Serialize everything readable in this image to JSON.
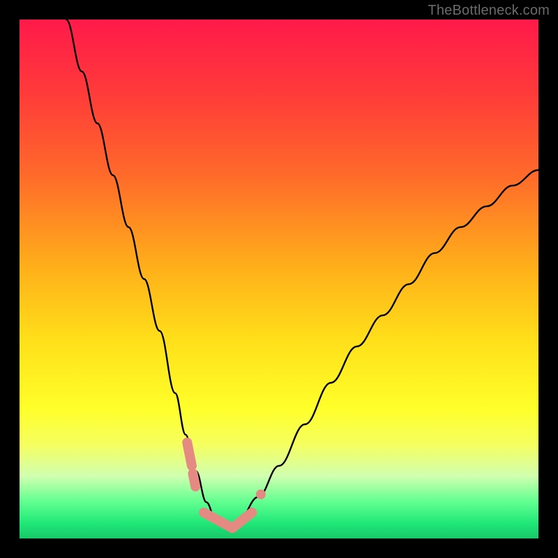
{
  "watermark": "TheBottleneck.com",
  "chart_data": {
    "type": "line",
    "title": "",
    "xlabel": "",
    "ylabel": "",
    "xlim": [
      0,
      100
    ],
    "ylim": [
      0,
      100
    ],
    "background_gradient": {
      "stops": [
        {
          "offset": 0.0,
          "color": "#ff1a4a"
        },
        {
          "offset": 0.14,
          "color": "#ff3a3a"
        },
        {
          "offset": 0.3,
          "color": "#ff6a2a"
        },
        {
          "offset": 0.48,
          "color": "#ffb01a"
        },
        {
          "offset": 0.62,
          "color": "#ffe01a"
        },
        {
          "offset": 0.75,
          "color": "#ffff2a"
        },
        {
          "offset": 0.82,
          "color": "#f5ff60"
        },
        {
          "offset": 0.88,
          "color": "#d0ffb0"
        },
        {
          "offset": 0.93,
          "color": "#60ff90"
        },
        {
          "offset": 0.97,
          "color": "#20e878"
        },
        {
          "offset": 1.0,
          "color": "#18c868"
        }
      ]
    },
    "series": [
      {
        "name": "bottleneck-curve",
        "x": [
          9.0,
          12.0,
          15.0,
          18.0,
          21.0,
          24.0,
          27.0,
          30.0,
          32.0,
          34.0,
          36.0,
          38.0,
          40.0,
          42.0,
          46.0,
          50.0,
          55.0,
          60.0,
          65.0,
          70.0,
          75.0,
          80.0,
          85.0,
          90.0,
          95.0,
          100.0
        ],
        "y": [
          100.0,
          90.0,
          80.0,
          70.0,
          60.0,
          50.0,
          40.0,
          28.0,
          20.0,
          13.0,
          7.0,
          3.0,
          2.0,
          3.0,
          8.0,
          14.0,
          22.0,
          30.0,
          37.0,
          43.0,
          49.0,
          55.0,
          60.0,
          64.0,
          68.0,
          71.0
        ]
      }
    ],
    "markers": {
      "name": "salmon-highlights",
      "color": "#e58a82",
      "segments": [
        {
          "x": [
            32.3,
            33.2
          ],
          "y": [
            18.5,
            14.0
          ]
        },
        {
          "x": [
            33.4,
            33.9
          ],
          "y": [
            12.5,
            10.0
          ]
        },
        {
          "x": [
            35.5,
            41.0
          ],
          "y": [
            5.0,
            2.0
          ]
        },
        {
          "x": [
            41.0,
            44.8
          ],
          "y": [
            2.0,
            5.0
          ]
        }
      ],
      "dots": [
        {
          "x": 46.5,
          "y": 8.5
        }
      ]
    }
  }
}
